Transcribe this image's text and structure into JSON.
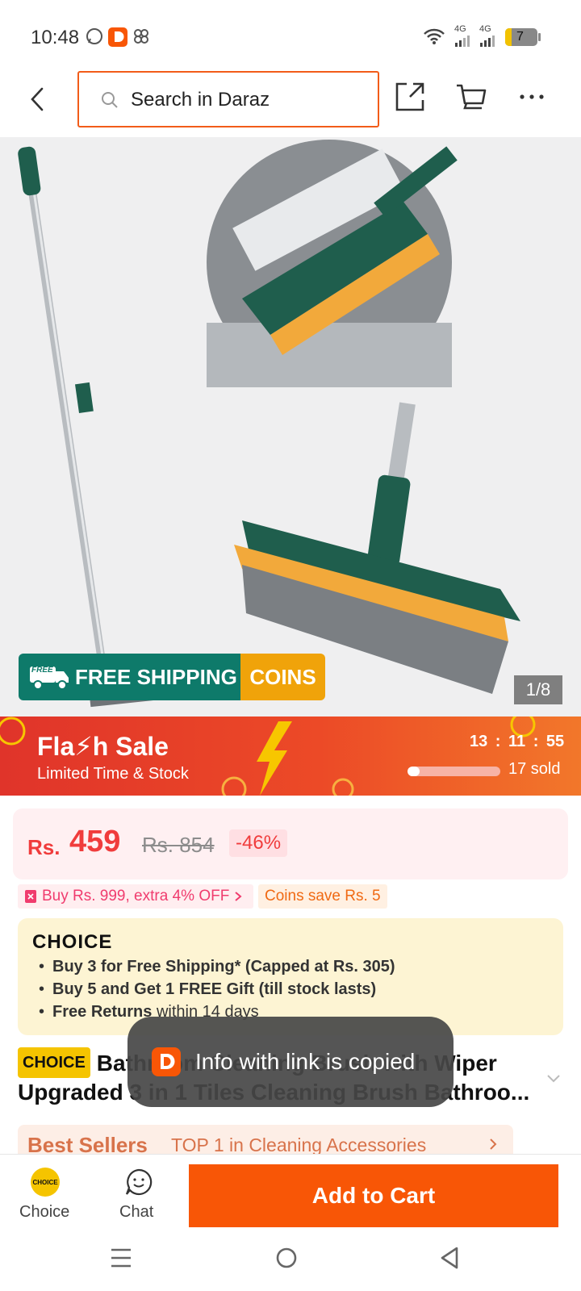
{
  "status_bar": {
    "time": "10:48",
    "network_1": "4G",
    "network_2": "4G",
    "battery": "7"
  },
  "header": {
    "search_placeholder": "Search in Daraz",
    "icons": [
      "back-arrow-icon",
      "search-icon",
      "share-icon",
      "cart-icon",
      "more-icon"
    ]
  },
  "gallery": {
    "badge_free_shipping": "FREE SHIPPING",
    "badge_free_small": "FREE",
    "badge_coins": "COINS",
    "counter": "1/8"
  },
  "flash_sale": {
    "title": "Fla⚡h Sale",
    "subtitle": "Limited Time & Stock",
    "timer": "13 : 11 : 55",
    "sold": "17 sold",
    "sold_progress": 0.13
  },
  "price": {
    "currency": "Rs.",
    "value": "459",
    "original": "Rs. 854",
    "discount": "-46%"
  },
  "promos": {
    "voucher": "Buy Rs. 999, extra 4% OFF",
    "coins": "Coins save Rs. 5"
  },
  "choice": {
    "logo": "CHOICE",
    "line1": "Buy 3 for  Free Shipping* (Capped at Rs. 305)",
    "line2": "Buy 5 and Get 1 FREE Gift (till stock lasts)",
    "line3_bold": "Free Returns",
    "line3_rest": " within 14 days"
  },
  "product": {
    "tag": "CHOICE",
    "title": "Bathroom Cleaning Brush with Wiper Upgraded 3 in 1 Tiles Cleaning Brush Bathroo..."
  },
  "best_sellers": {
    "label": "Best Sellers",
    "rank": "TOP 1 in Cleaning Accessories"
  },
  "toast": {
    "text": "Info with link is copied"
  },
  "bottom_bar": {
    "choice_label": "Choice",
    "choice_badge": "CHOICE",
    "chat_label": "Chat",
    "add_to_cart": "Add to Cart"
  },
  "colors": {
    "brand_orange": "#f85606",
    "flash_red": "#e0342a",
    "price_red": "#f03c3c",
    "free_ship_green": "#0e7a6a",
    "coins_yellow": "#f0a30a"
  }
}
